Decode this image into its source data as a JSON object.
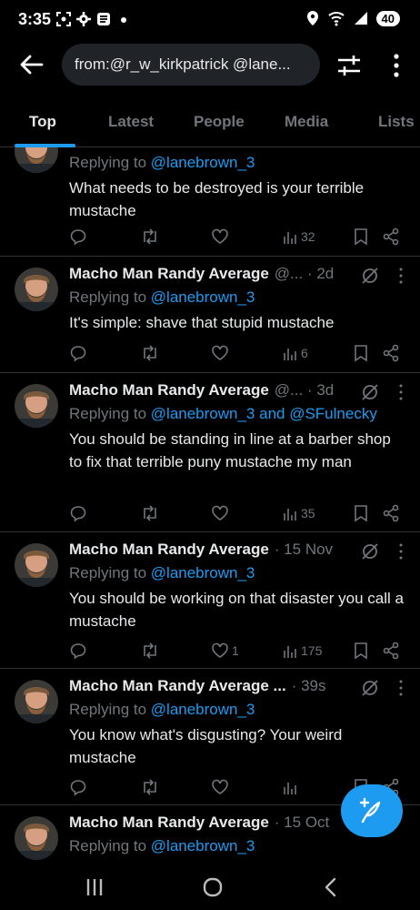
{
  "status": {
    "time": "3:35",
    "battery": "40"
  },
  "search": {
    "query": "from:@r_w_kirkpatrick @lane..."
  },
  "tabs": [
    {
      "label": "Top"
    },
    {
      "label": "Latest"
    },
    {
      "label": "People"
    },
    {
      "label": "Media"
    },
    {
      "label": "Lists"
    }
  ],
  "tweets": [
    {
      "name": "",
      "meta": "",
      "replying_prefix": "Replying to ",
      "replying_to": "@lanebrown_3",
      "body": "What needs to be destroyed is your terrible mustache",
      "likes": "",
      "views": "32"
    },
    {
      "name": "Macho Man Randy Average",
      "meta": "@... · 2d",
      "replying_prefix": "Replying to ",
      "replying_to": "@lanebrown_3",
      "body": "It's simple: shave that stupid mustache",
      "likes": "",
      "views": "6"
    },
    {
      "name": "Macho Man Randy Average",
      "meta": "@... · 3d",
      "replying_prefix": "Replying to ",
      "replying_to": "@lanebrown_3 and @SFulnecky",
      "body": "You should be standing in line at a barber shop to fix that terrible puny mustache my man",
      "likes": "",
      "views": "35"
    },
    {
      "name": "Macho Man Randy Average",
      "meta": "· 15 Nov",
      "replying_prefix": "Replying to ",
      "replying_to": "@lanebrown_3",
      "body": "You should be working on that disaster you call a mustache",
      "likes": "1",
      "views": "175"
    },
    {
      "name": "Macho Man Randy Average ...",
      "meta": "· 39s",
      "replying_prefix": "Replying to ",
      "replying_to": "@lanebrown_3",
      "body": "You know what's disgusting? Your weird mustache",
      "likes": "",
      "views": ""
    },
    {
      "name": "Macho Man Randy Average",
      "meta": "· 15 Oct",
      "replying_prefix": "Replying to ",
      "replying_to": "@lanebrown_3",
      "body": "",
      "likes": "",
      "views": ""
    }
  ],
  "colors": {
    "accent": "#1d9bf0",
    "muted": "#71767b",
    "text": "#e7e9ea",
    "bg": "#000000"
  }
}
